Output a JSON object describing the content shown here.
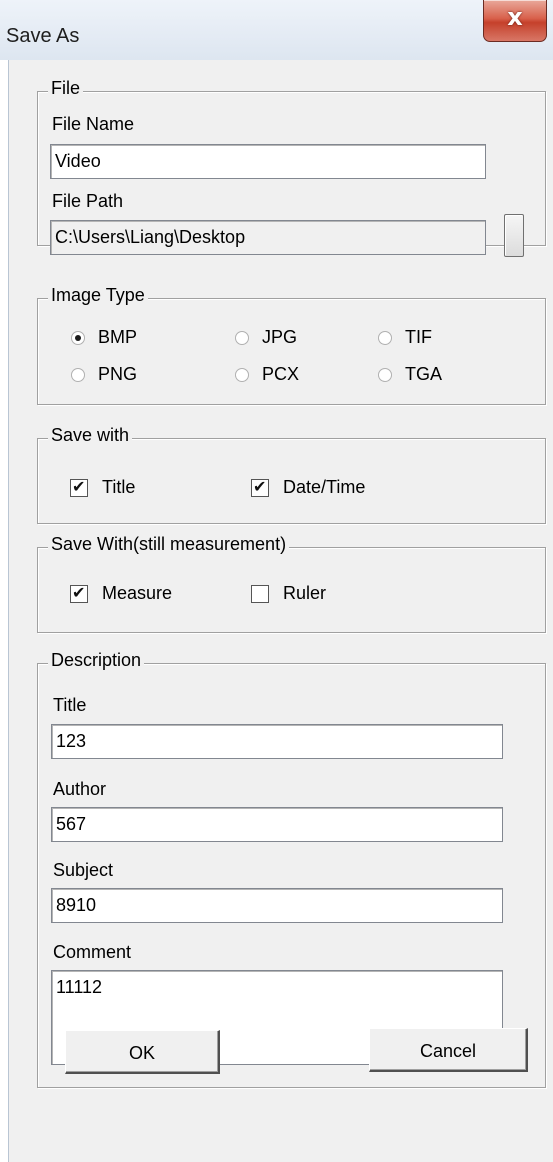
{
  "window": {
    "title": "Save As",
    "close_glyph": "x"
  },
  "file": {
    "legend": "File",
    "name_label": "File Name",
    "name_value": "Video",
    "path_label": "File Path",
    "path_value": "C:\\Users\\Liang\\Desktop"
  },
  "image_type": {
    "legend": "Image Type",
    "selected": "BMP",
    "options": [
      "BMP",
      "JPG",
      "TIF",
      "PNG",
      "PCX",
      "TGA"
    ]
  },
  "save_with": {
    "legend": "Save with",
    "title_label": "Title",
    "title_checked": true,
    "datetime_label": "Date/Time",
    "datetime_checked": true
  },
  "save_with_still": {
    "legend": "Save With(still measurement)",
    "measure_label": "Measure",
    "measure_checked": true,
    "ruler_label": "Ruler",
    "ruler_checked": false
  },
  "description": {
    "legend": "Description",
    "title_label": "Title",
    "title_value": "123",
    "author_label": "Author",
    "author_value": "567",
    "subject_label": "Subject",
    "subject_value": "8910",
    "comment_label": "Comment",
    "comment_value": "11112"
  },
  "buttons": {
    "ok": "OK",
    "cancel": "Cancel"
  },
  "icons": {
    "close": "close-icon",
    "check": "check-icon",
    "radio_dot": "radio-dot-icon"
  },
  "colors": {
    "dialog_bg": "#f0f0f0",
    "close_red": "#c5402b",
    "titlebar": "#e4ebf4"
  }
}
